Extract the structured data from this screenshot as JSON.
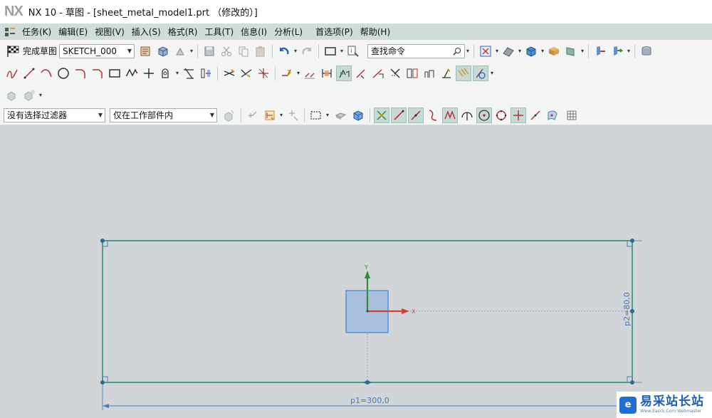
{
  "window": {
    "logo": "NX",
    "title": "NX 10 - 草图 - [sheet_metal_model1.prt （修改的）]"
  },
  "menu": {
    "items": [
      "任务(K)",
      "编辑(E)",
      "视图(V)",
      "插入(S)",
      "格式(R)",
      "工具(T)",
      "信息(I)",
      "分析(L)",
      "首选项(P)",
      "帮助(H)"
    ]
  },
  "toolbar": {
    "finish_sketch_label": "完成草图",
    "sketch_name": "SKETCH_000",
    "command_search_placeholder": "查找命令"
  },
  "selection_bar": {
    "filter": "没有选择过滤器",
    "scope": "仅在工作部件内"
  },
  "sketch": {
    "dim_horizontal": "p1=300,0",
    "dim_vertical": "p2=80,0",
    "axis_x_label": "X",
    "axis_y_label": "Y"
  },
  "watermark": {
    "logo_glyph": "e",
    "text_cn": "易采站长站",
    "text_en": "Www.Easck.Com Webmaster"
  },
  "colors": {
    "sketch_line": "#2e8b78",
    "dimension": "#4a78b8",
    "x_axis": "#d23b3b",
    "y_axis": "#2f8a3a",
    "highlight_square": "#a8c0dd"
  }
}
